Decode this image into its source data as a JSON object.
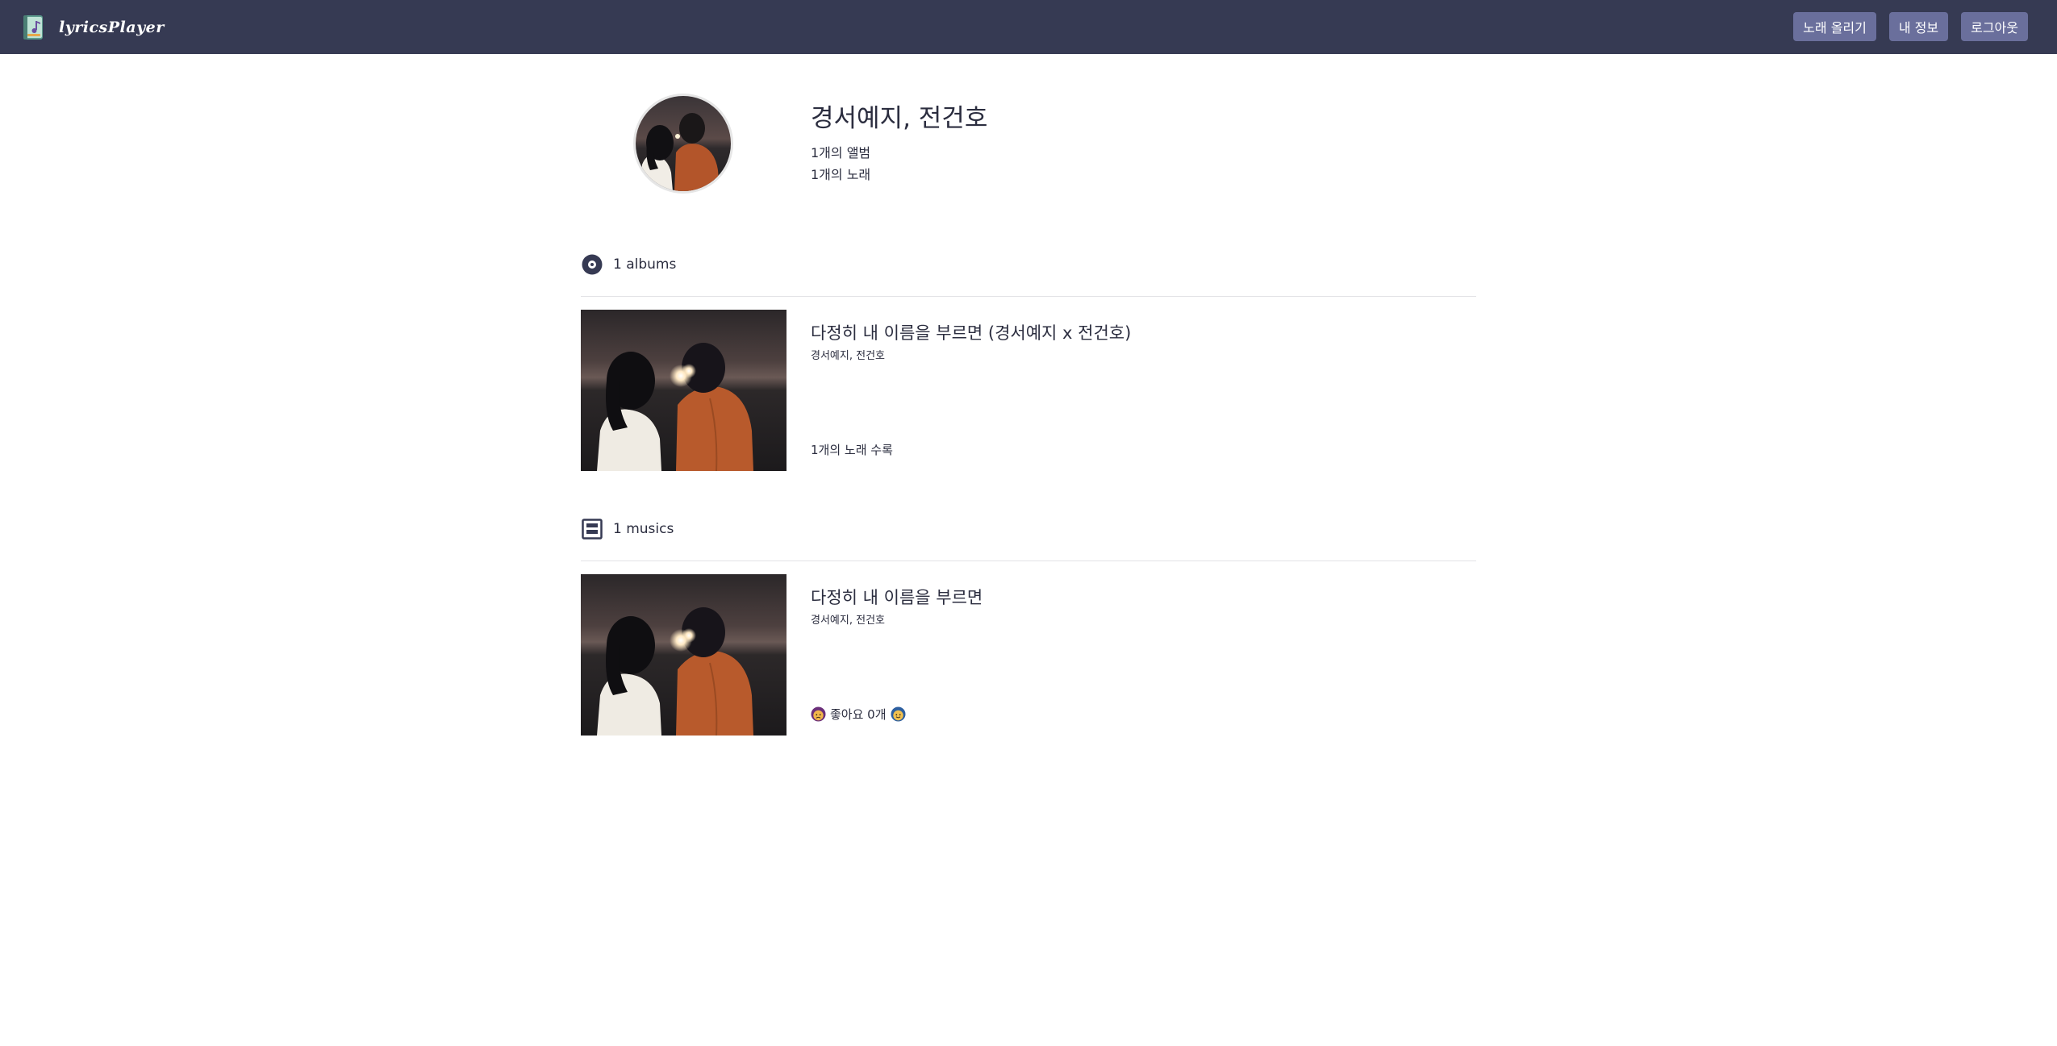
{
  "app": {
    "name": "lyricsPlayer",
    "logo_icon": "music-book-icon"
  },
  "nav": {
    "upload_label": "노래 올리기",
    "profile_label": "내 정보",
    "logout_label": "로그아웃"
  },
  "colors": {
    "navbar_bg": "#363a53",
    "nav_button_bg": "#6a6f9c",
    "text": "#2b2d3f",
    "divider": "#e3e3e6"
  },
  "artist": {
    "name": "경서예지, 전건호",
    "album_count_text": "1개의 앨범",
    "song_count_text": "1개의 노래"
  },
  "albums_section": {
    "icon": "disc-icon",
    "label": "1 albums",
    "items": [
      {
        "title": "다정히 내 이름을 부르면 (경서예지 x 전건호)",
        "artist": "경서예지, 전건호",
        "track_count_text": "1개의 노래 수록"
      }
    ]
  },
  "musics_section": {
    "icon": "music-list-icon",
    "label": "1 musics",
    "items": [
      {
        "title": "다정히 내 이름을 부르면",
        "artist": "경서예지, 전건호",
        "likes_text": "좋아요 0개",
        "dislike_icon": "sad-face-icon",
        "like_icon": "happy-face-icon"
      }
    ]
  }
}
